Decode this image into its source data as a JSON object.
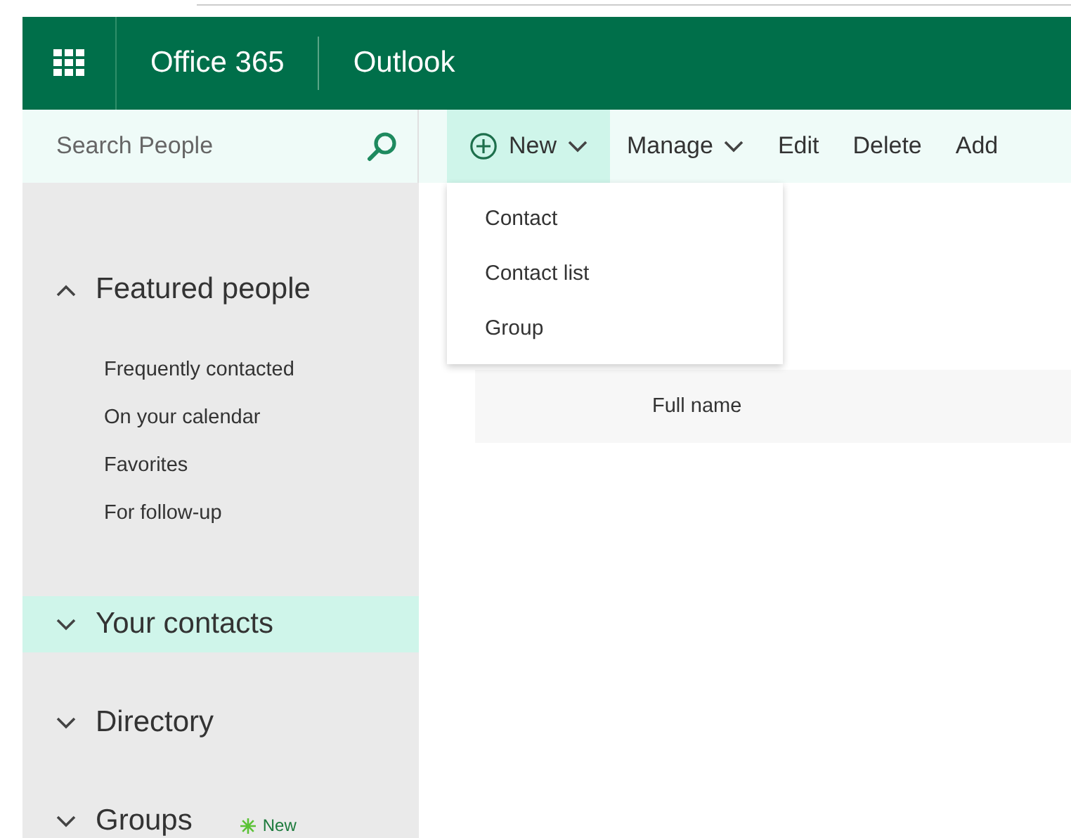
{
  "header": {
    "suite": "Office 365",
    "app": "Outlook"
  },
  "search": {
    "placeholder": "Search People"
  },
  "toolbar": [
    {
      "label": "New",
      "kind": "new",
      "expanded": true
    },
    {
      "label": "Manage",
      "kind": "dropdown",
      "expanded": false
    },
    {
      "label": "Edit",
      "kind": "action"
    },
    {
      "label": "Delete",
      "kind": "action"
    },
    {
      "label": "Add",
      "kind": "action"
    }
  ],
  "new_menu": [
    "Contact",
    "Contact list",
    "Group"
  ],
  "sidebar": [
    {
      "title": "Featured people",
      "expanded": true,
      "selected": false,
      "children": [
        {
          "label": "Frequently contacted"
        },
        {
          "label": "On your calendar"
        },
        {
          "label": "Favorites"
        },
        {
          "label": "For follow-up"
        }
      ]
    },
    {
      "title": "Your contacts",
      "expanded": false,
      "selected": true
    },
    {
      "title": "Directory",
      "expanded": false,
      "selected": false
    },
    {
      "title": "Groups",
      "expanded": false,
      "selected": false,
      "badge": "New"
    }
  ],
  "table": {
    "columns": [
      "Full name"
    ]
  }
}
